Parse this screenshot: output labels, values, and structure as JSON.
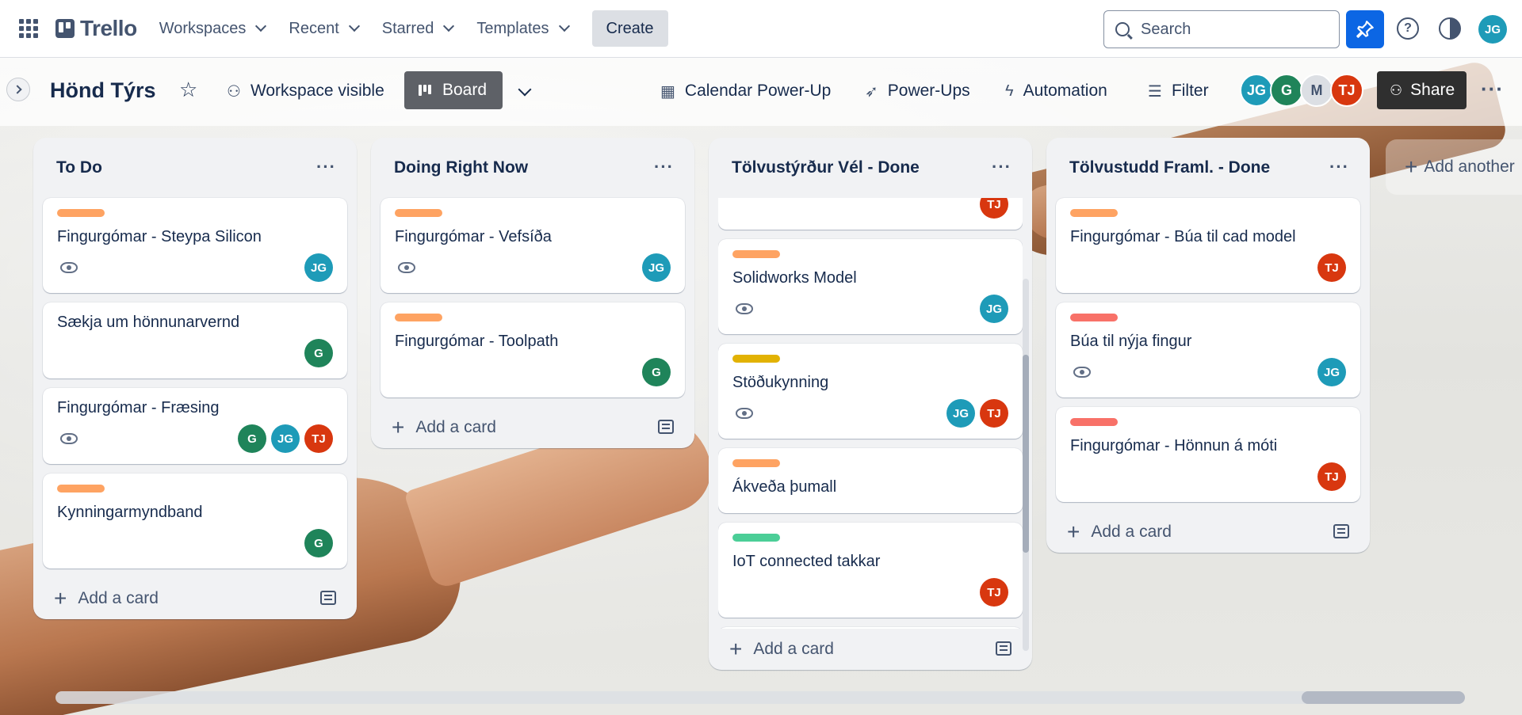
{
  "nav": {
    "logo": "Trello",
    "menus": [
      "Workspaces",
      "Recent",
      "Starred",
      "Templates"
    ],
    "create_label": "Create",
    "search_placeholder": "Search",
    "user_initials": "JG"
  },
  "board": {
    "title": "Hönd Týrs",
    "visibility_label": "Workspace visible",
    "view_label": "Board",
    "calendar_label": "Calendar Power-Up",
    "powerups_label": "Power-Ups",
    "automation_label": "Automation",
    "filter_label": "Filter",
    "members": [
      "JG",
      "G",
      "M",
      "TJ"
    ],
    "share_label": "Share",
    "add_list_label": "Add another"
  },
  "lists": [
    {
      "title": "To Do",
      "add_label": "Add a card",
      "cards": [
        {
          "label_color": "#fea362",
          "title": "Fingurgómar - Steypa Silicon",
          "watch": true,
          "members": [
            "JG"
          ]
        },
        {
          "label_color": "",
          "title": "Sækja um hönnunarvernd",
          "watch": false,
          "members": [
            "G"
          ]
        },
        {
          "label_color": "",
          "title": "Fingurgómar - Fræsing",
          "watch": true,
          "members": [
            "G",
            "JG",
            "TJ"
          ]
        },
        {
          "label_color": "#fea362",
          "title": "Kynningarmyndband",
          "watch": false,
          "members": [
            "G"
          ]
        }
      ]
    },
    {
      "title": "Doing Right Now",
      "add_label": "Add a card",
      "cards": [
        {
          "label_color": "#fea362",
          "title": "Fingurgómar - Vefsíða",
          "watch": true,
          "members": [
            "JG"
          ]
        },
        {
          "label_color": "#fea362",
          "title": "Fingurgómar - Toolpath",
          "watch": false,
          "members": [
            "G"
          ]
        }
      ]
    },
    {
      "title": "Tölvustýrður Vél - Done",
      "add_label": "Add a card",
      "cards": [
        {
          "label_color": "",
          "title": "",
          "watch": false,
          "members": [
            "TJ"
          ],
          "partial": true
        },
        {
          "label_color": "#fea362",
          "title": "Solidworks Model",
          "watch": true,
          "members": [
            "JG"
          ]
        },
        {
          "label_color": "#e2b203",
          "title": "Stöðukynning",
          "watch": true,
          "members": [
            "JG",
            "TJ"
          ]
        },
        {
          "label_color": "#fea362",
          "title": "Ákveða þumall",
          "watch": false,
          "members": []
        },
        {
          "label_color": "#4bce97",
          "title": "IoT connected takkar",
          "watch": false,
          "members": [
            "TJ"
          ]
        },
        {
          "label_color": "#fea362",
          "title": "",
          "watch": false,
          "members": [],
          "partial": true
        }
      ]
    },
    {
      "title": "Tölvustudd Framl. - Done",
      "add_label": "Add a card",
      "cards": [
        {
          "label_color": "#fea362",
          "title": "Fingurgómar - Búa til cad model",
          "watch": false,
          "members": [
            "TJ"
          ]
        },
        {
          "label_color": "#f87168",
          "title": "Búa til nýja fingur",
          "watch": true,
          "members": [
            "JG"
          ]
        },
        {
          "label_color": "#f87168",
          "title": "Fingurgómar - Hönnun á móti",
          "watch": false,
          "members": [
            "TJ"
          ]
        }
      ]
    }
  ],
  "colors": {
    "JG": "#1e9bb8",
    "G": "#1f845a",
    "TJ": "#d8370f",
    "M": "#dcdfe4",
    "accent": "#0c66e4"
  }
}
